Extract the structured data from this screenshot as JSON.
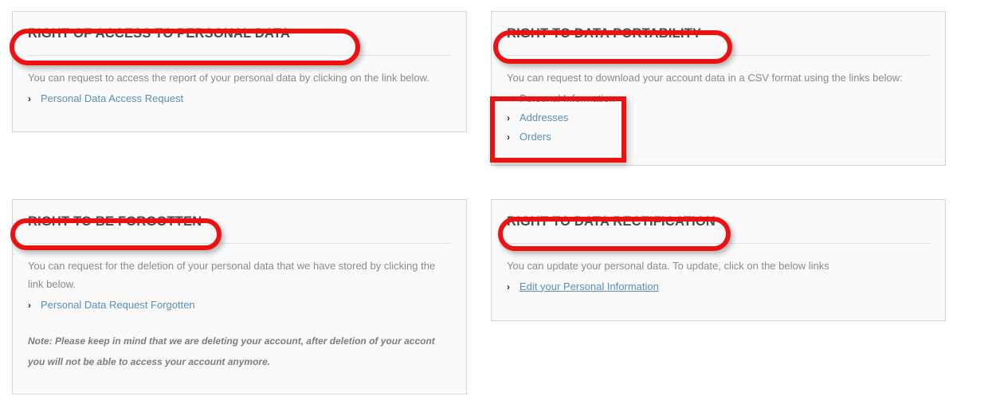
{
  "page": {
    "background_color": "#ffffff",
    "panel_background_color": "#fafafa",
    "panel_border_color": "#d6d6d6",
    "heading_color": "#4a4a4a",
    "body_text_color": "#8a8a8a",
    "link_color": "#5a8fb5",
    "annotation_color": "#ee1111"
  },
  "panels": {
    "access": {
      "title": "RIGHT OF ACCESS TO PERSONAL DATA",
      "description": "You can request to access the report of your personal data by clicking on the link below.",
      "links": [
        {
          "label": "Personal Data Access Request",
          "icon": "chevron-right-icon",
          "underlined": false
        }
      ]
    },
    "portability": {
      "title": "RIGHT TO DATA PORTABILITY",
      "description": "You can request to download your account data in a CSV format using the links below:",
      "links": [
        {
          "label": "Personal Information",
          "icon": "chevron-right-icon",
          "underlined": false
        },
        {
          "label": "Addresses",
          "icon": "chevron-right-icon",
          "underlined": false
        },
        {
          "label": "Orders",
          "icon": "chevron-right-icon",
          "underlined": false
        }
      ]
    },
    "forgotten": {
      "title": "RIGHT TO BE FORGOTTEN",
      "description": "You can request for the deletion of your personal data that we have stored by clicking the link below.",
      "links": [
        {
          "label": "Personal Data Request Forgotten",
          "icon": "chevron-right-icon",
          "underlined": false
        }
      ],
      "note": "Note: Please keep in mind that we are deleting your account, after deletion of your accont you will not be able to access your account anymore."
    },
    "rectification": {
      "title": "RIGHT TO DATA RECTIFICATION",
      "description": "You can update your personal data. To update, click on the below links",
      "links": [
        {
          "label": "Edit your Personal Information",
          "icon": "chevron-right-icon",
          "underlined": true
        }
      ]
    }
  },
  "icons": {
    "chevron": "›"
  },
  "annotations": [
    {
      "name": "annotation-access-title",
      "shape": "rounded-rectangle"
    },
    {
      "name": "annotation-portability-title",
      "shape": "rounded-rectangle"
    },
    {
      "name": "annotation-portability-links",
      "shape": "rectangle"
    },
    {
      "name": "annotation-forgotten-title",
      "shape": "rounded-rectangle"
    },
    {
      "name": "annotation-rectification-title",
      "shape": "rounded-rectangle"
    }
  ]
}
